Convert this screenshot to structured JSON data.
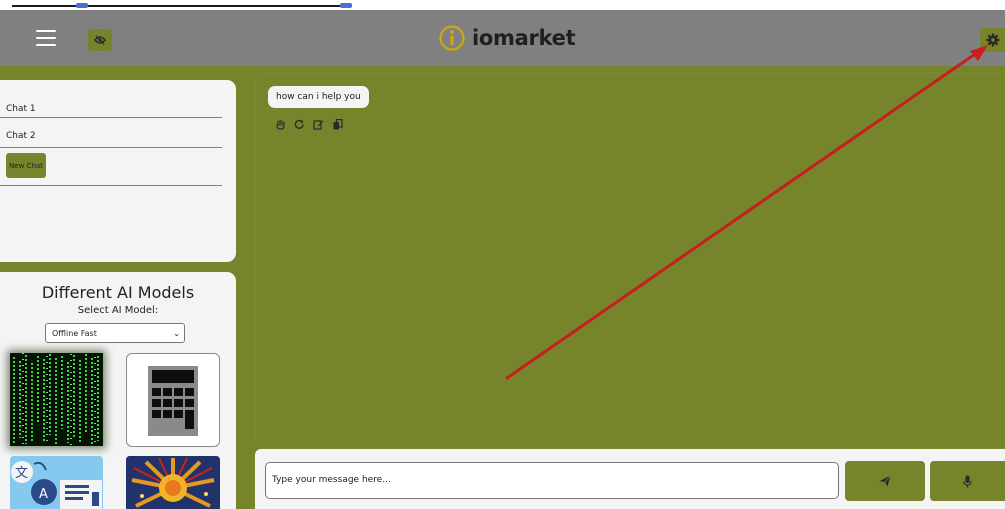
{
  "header": {
    "logo_text": "iomarket",
    "menu_icon": "hamburger-icon",
    "visibility_icon": "eye-slash-icon",
    "settings_icon": "gear-icon"
  },
  "sidebar": {
    "chats": [
      {
        "label": "Chat 1"
      },
      {
        "label": "Chat 2"
      }
    ],
    "new_chat_label": "New Chat",
    "models": {
      "title": "Different AI Models",
      "select_label": "Select AI Model:",
      "selected": "Offline Fast"
    }
  },
  "chat": {
    "messages": [
      {
        "text": "how can i help you"
      }
    ]
  },
  "composer": {
    "placeholder": "Type your message here..."
  },
  "colors": {
    "accent": "#76842b",
    "header": "#808080",
    "panel": "#f4f4f4",
    "annotation_arrow": "#c81e1e"
  }
}
